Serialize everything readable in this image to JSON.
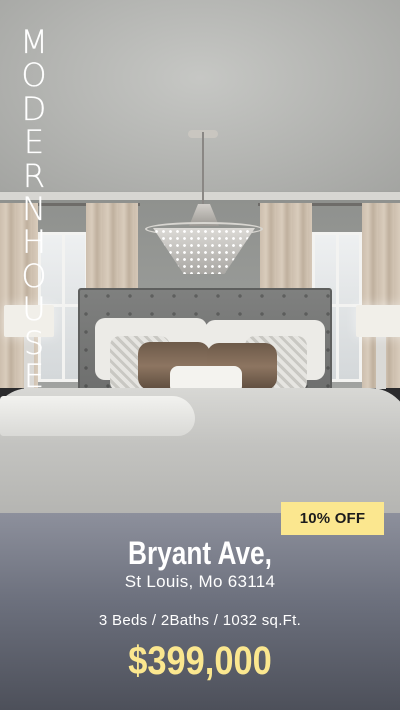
{
  "title_letters": [
    "M",
    "O",
    "D",
    "E",
    "R",
    "N",
    "H",
    "O",
    "U",
    "S",
    "E"
  ],
  "badge": "10% OFF",
  "listing": {
    "street": "Bryant Ave,",
    "city": "St Louis, Mo 63114",
    "details": "3 Beds / 2Baths / 1032 sq.Ft.",
    "price": "$399,000"
  },
  "colors": {
    "accent": "#fbe78f",
    "panel_top": "#8d909c",
    "panel_bottom": "#4d505a",
    "title_text": "#ffffff"
  }
}
